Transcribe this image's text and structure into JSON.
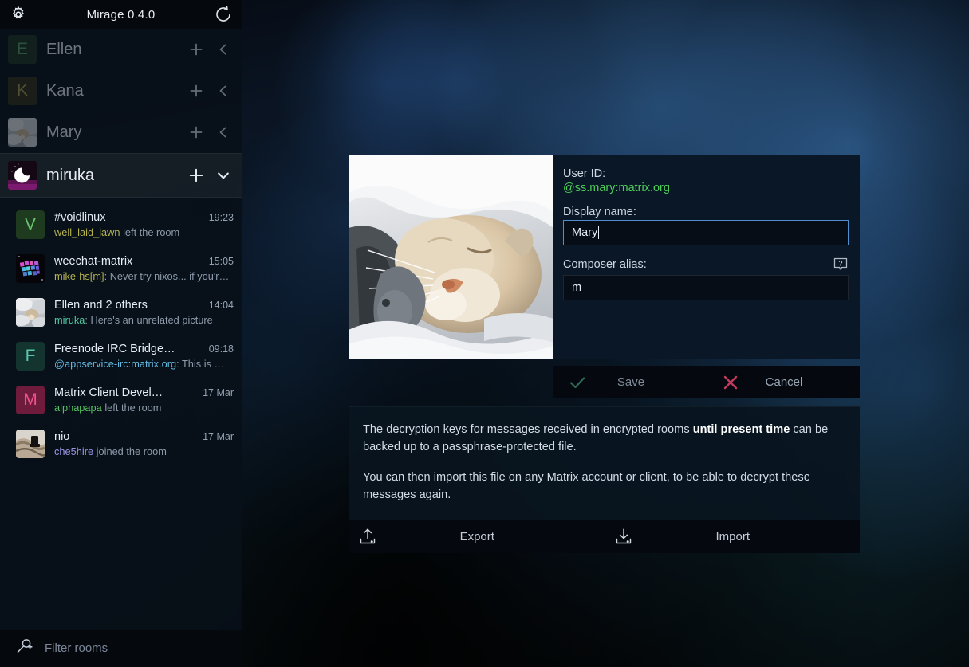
{
  "app": {
    "title": "Mirage 0.4.0",
    "settings_icon": "gear-icon",
    "reload_icon": "refresh-icon"
  },
  "accounts": [
    {
      "name": "Ellen",
      "initial": "E",
      "avatar_type": "letter",
      "bg": "#1d3324",
      "fg": "#57a06a",
      "expanded": false,
      "active": false,
      "add_label": "+",
      "collapse_icon": "chevron-left-icon"
    },
    {
      "name": "Kana",
      "initial": "K",
      "avatar_type": "letter",
      "bg": "#33301a",
      "fg": "#a59a55",
      "expanded": false,
      "active": false,
      "add_label": "+",
      "collapse_icon": "chevron-left-icon"
    },
    {
      "name": "Mary",
      "initial": "",
      "avatar_type": "photo-cat",
      "bg": "#8c9095",
      "fg": "#ffffff",
      "expanded": false,
      "active": false,
      "add_label": "+",
      "collapse_icon": "chevron-left-icon"
    },
    {
      "name": "miruka",
      "initial": "",
      "avatar_type": "photo-moon",
      "bg": "#16060f",
      "fg": "#ffffff",
      "expanded": true,
      "active": true,
      "add_label": "+",
      "collapse_icon": "chevron-down-icon"
    }
  ],
  "rooms": [
    {
      "title": "#voidlinux",
      "time": "19:23",
      "sender": "well_laid_lawn",
      "sender_color": "#b7b450",
      "message": " left the room",
      "avatar_type": "letter",
      "initial": "V",
      "bg": "#1e3b1f",
      "fg": "#69c46d"
    },
    {
      "title": "weechat-matrix",
      "time": "15:05",
      "sender": "mike-hs[m]",
      "sender_color": "#b7b450",
      "message": ": Never try nixos... if you'r…",
      "avatar_type": "photo-pixel",
      "initial": "",
      "bg": "#05060a",
      "fg": "#ffffff"
    },
    {
      "title": "Ellen and 2 others",
      "time": "14:04",
      "sender": "miruka",
      "sender_color": "#4fc9a0",
      "message": ": Here's an unrelated picture",
      "avatar_type": "photo-cat",
      "initial": "",
      "bg": "#b9bdc2",
      "fg": "#ffffff"
    },
    {
      "title": "Freenode IRC Bridge…",
      "time": "09:18",
      "sender": "@appservice-irc:matrix.org",
      "sender_color": "#64b8e0",
      "message": ": This is …",
      "avatar_type": "letter",
      "initial": "F",
      "bg": "#14352f",
      "fg": "#56c7ae"
    },
    {
      "title": "Matrix Client Devel…",
      "time": "17 Mar",
      "sender": "alphapapa",
      "sender_color": "#54c25f",
      "message": " left the room",
      "avatar_type": "letter",
      "initial": "M",
      "bg": "#6e1b3c",
      "fg": "#f0538c"
    },
    {
      "title": "nio",
      "time": "17 Mar",
      "sender": "che5hire",
      "sender_color": "#9b95e2",
      "message": " joined the room",
      "avatar_type": "photo-snake",
      "initial": "",
      "bg": "#a59a8c",
      "fg": "#ffffff"
    }
  ],
  "filter": {
    "placeholder": "Filter rooms",
    "icon": "search-add-icon"
  },
  "account_settings": {
    "user_id_label": "User ID:",
    "user_id_value": "@ss.mary:matrix.org",
    "display_name_label": "Display name:",
    "display_name_value": "Mary",
    "composer_alias_label": "Composer alias:",
    "composer_alias_value": "m",
    "help_icon": "help-tooltip-icon",
    "save_label": "Save",
    "save_icon": "check-icon",
    "cancel_label": "Cancel",
    "cancel_icon": "cross-icon"
  },
  "encryption_keys": {
    "paragraph1_before": "The decryption keys for messages received in encrypted rooms ",
    "paragraph1_bold": "until present time",
    "paragraph1_after": " can be backed up to a passphrase-protected file.",
    "paragraph2": "You can then import this file on any Matrix account or client, to be able to decrypt these messages again.",
    "export_label": "Export",
    "export_icon": "upload-icon",
    "import_label": "Import",
    "import_icon": "download-icon"
  },
  "colors": {
    "accent_green": "#4fcf5a",
    "focus_blue": "#4f8fd0",
    "cancel_red": "#c43a5e",
    "sidebar_bg": "#080f18"
  }
}
